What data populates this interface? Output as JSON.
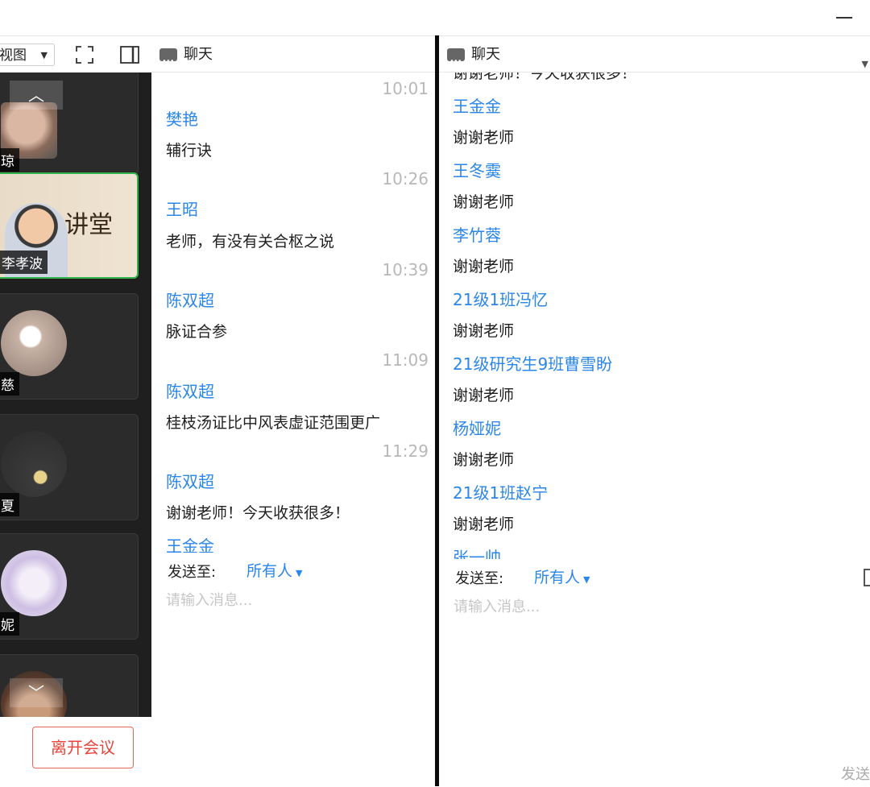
{
  "left_window": {
    "toolbar": {
      "view_label": "视图"
    },
    "participants": [
      {
        "name": "琼"
      },
      {
        "name": "李孝波"
      },
      {
        "name": "慈"
      },
      {
        "name": "夏"
      },
      {
        "name": "妮"
      }
    ],
    "leave_label": "离开会议",
    "chat": {
      "title": "聊天",
      "messages": [
        {
          "time": "10:01",
          "sender": "樊艳",
          "text": "辅行诀"
        },
        {
          "time": "10:26",
          "sender": "王昭",
          "text": "老师，有没有关合枢之说"
        },
        {
          "time": "10:39",
          "sender": "陈双超",
          "text": "脉证合参"
        },
        {
          "time": "11:09",
          "sender": "陈双超",
          "text": "桂枝汤证比中风表虚证范围更广"
        },
        {
          "time": "11:29",
          "sender": "陈双超",
          "text": "谢谢老师！今天收获很多！"
        }
      ],
      "trailing_sender": "王金金",
      "send_to_label": "发送至:",
      "recipient": "所有人",
      "input_placeholder": "请输入消息..."
    }
  },
  "right_window": {
    "chat": {
      "title": "聊天",
      "clipped_top_text": "谢谢老师！今天收获很多！",
      "messages": [
        {
          "sender": "王金金",
          "text": "谢谢老师"
        },
        {
          "sender": "王冬霙",
          "text": "谢谢老师"
        },
        {
          "sender": "李竹蓉",
          "text": "谢谢老师"
        },
        {
          "sender": "21级1班冯忆",
          "text": "谢谢老师"
        },
        {
          "sender": "21级研究生9班曹雪盼",
          "text": "谢谢老师"
        },
        {
          "sender": "杨娅妮",
          "text": "谢谢老师"
        },
        {
          "sender": "21级1班赵宁",
          "text": "谢谢老师"
        }
      ],
      "trailing_sender": "张一帅",
      "send_to_label": "发送至:",
      "recipient": "所有人",
      "input_placeholder": "请输入消息...",
      "send_label": "发送"
    }
  },
  "colors": {
    "accent": "#2a86e8",
    "leave": "#e8453c",
    "active_tile": "#2fb34a"
  }
}
